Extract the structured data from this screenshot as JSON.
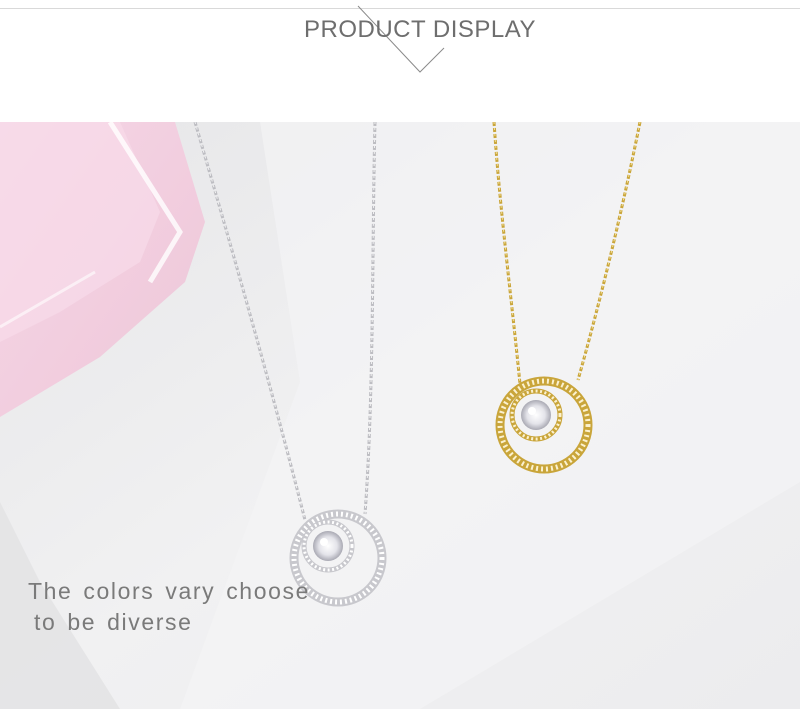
{
  "header": {
    "title": "PRODUCT DISPLAY"
  },
  "photo": {
    "subject": "two circle pendant necklaces",
    "colors": {
      "silver": "#c9c9cc",
      "gold": "#c9a53a",
      "background": "#efeff0",
      "pink_glass": "#f0c8dc"
    }
  },
  "caption": {
    "line1": "The colors vary choose",
    "line2": "to be diverse"
  }
}
